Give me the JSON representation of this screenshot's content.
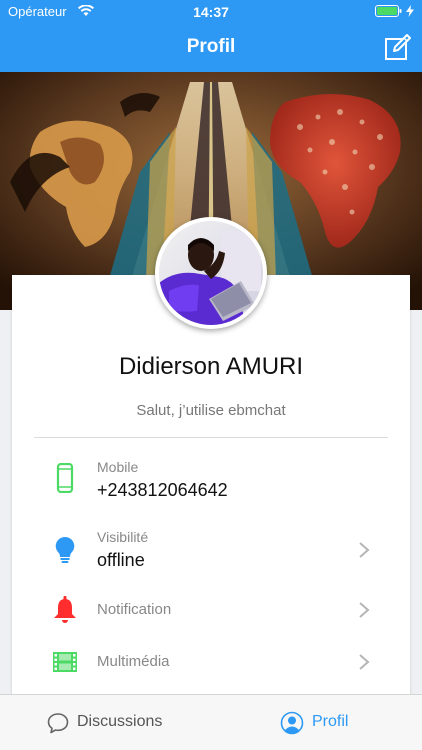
{
  "status_bar": {
    "carrier": "Opérateur",
    "time": "14:37"
  },
  "nav": {
    "title": "Profil",
    "edit_icon": "edit-icon"
  },
  "profile": {
    "name": "Didierson AMURI",
    "status": "Salut, j’utilise ebmchat"
  },
  "rows": {
    "mobile": {
      "label": "Mobile",
      "value": "+243812064642",
      "icon": "mobile-phone-icon",
      "color": "#4cd964"
    },
    "visibility": {
      "label": "Visibilité",
      "value": "offline",
      "icon": "lightbulb-icon",
      "color": "#2d99f4"
    },
    "notification": {
      "label": "Notification",
      "icon": "bell-icon",
      "color": "#ff2d2d"
    },
    "media": {
      "label": "Multimédia",
      "icon": "film-icon",
      "color": "#4cd964"
    }
  },
  "tabs": {
    "discussions": {
      "label": "Discussions",
      "icon": "chat-bubble-icon"
    },
    "profile": {
      "label": "Profil",
      "icon": "user-icon",
      "active": true
    }
  },
  "colors": {
    "accent": "#2d99f4",
    "active_tab": "#2d99f4",
    "inactive_tab": "#555555"
  }
}
